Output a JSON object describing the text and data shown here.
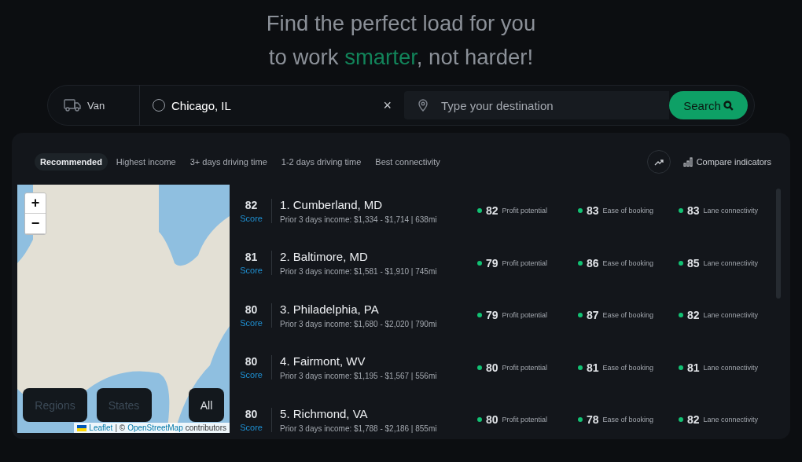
{
  "heading": {
    "line_1": "Find the perfect load for you",
    "line_2": [
      {
        "text": "to work ",
        "accent": false
      },
      {
        "text": "smarter",
        "accent": true
      },
      {
        "text": ", not harder!",
        "accent": false
      }
    ]
  },
  "search_bar": {
    "equipment": "Van",
    "origin": "Chicago, IL",
    "clear": "×",
    "destination_placeholder": "Type your destination",
    "search_button": "Search"
  },
  "tabs": [
    {
      "label": "Recommended",
      "selected": true
    },
    {
      "label": "Highest income",
      "selected": false
    },
    {
      "label": "3+ days driving time",
      "selected": false
    },
    {
      "label": "1-2 days driving time",
      "selected": false
    },
    {
      "label": "Best connectivity",
      "selected": false
    }
  ],
  "compare_button": "Compare indicators",
  "map": {
    "zoom_in": "+",
    "zoom_out": "−",
    "filters": [
      {
        "label": "Regions",
        "selected": false
      },
      {
        "label": "States",
        "selected": false
      },
      {
        "label": "All",
        "selected": true
      }
    ],
    "attribution": {
      "leaflet": "Leaflet",
      "separator": "| ©",
      "osm": "OpenStreetMap",
      "suffix": "contributors"
    }
  },
  "results": [
    {
      "score": "82",
      "score_label": "Score",
      "title": "1. Cumberland, MD",
      "detail": "Prior 3 days income: $1,334 - $1,714 | 638mi",
      "metrics": [
        {
          "value": "82",
          "label": "Profit potential"
        },
        {
          "value": "83",
          "label": "Ease of booking"
        },
        {
          "value": "83",
          "label": "Lane connectivity"
        }
      ]
    },
    {
      "score": "81",
      "score_label": "Score",
      "title": "2. Baltimore, MD",
      "detail": "Prior 3 days income: $1,581 - $1,910 | 745mi",
      "metrics": [
        {
          "value": "79",
          "label": "Profit potential"
        },
        {
          "value": "86",
          "label": "Ease of booking"
        },
        {
          "value": "85",
          "label": "Lane connectivity"
        }
      ]
    },
    {
      "score": "80",
      "score_label": "Score",
      "title": "3. Philadelphia, PA",
      "detail": "Prior 3 days income: $1,680 - $2,020 | 790mi",
      "metrics": [
        {
          "value": "79",
          "label": "Profit potential"
        },
        {
          "value": "87",
          "label": "Ease of booking"
        },
        {
          "value": "82",
          "label": "Lane connectivity"
        }
      ]
    },
    {
      "score": "80",
      "score_label": "Score",
      "title": "4. Fairmont, WV",
      "detail": "Prior 3 days income: $1,195 - $1,567 | 556mi",
      "metrics": [
        {
          "value": "80",
          "label": "Profit potential"
        },
        {
          "value": "81",
          "label": "Ease of booking"
        },
        {
          "value": "81",
          "label": "Lane connectivity"
        }
      ]
    },
    {
      "score": "80",
      "score_label": "Score",
      "title": "5. Richmond, VA",
      "detail": "Prior 3 days income: $1,788 - $2,186 | 855mi",
      "metrics": [
        {
          "value": "80",
          "label": "Profit potential"
        },
        {
          "value": "78",
          "label": "Ease of booking"
        },
        {
          "value": "82",
          "label": "Lane connectivity"
        }
      ]
    }
  ]
}
